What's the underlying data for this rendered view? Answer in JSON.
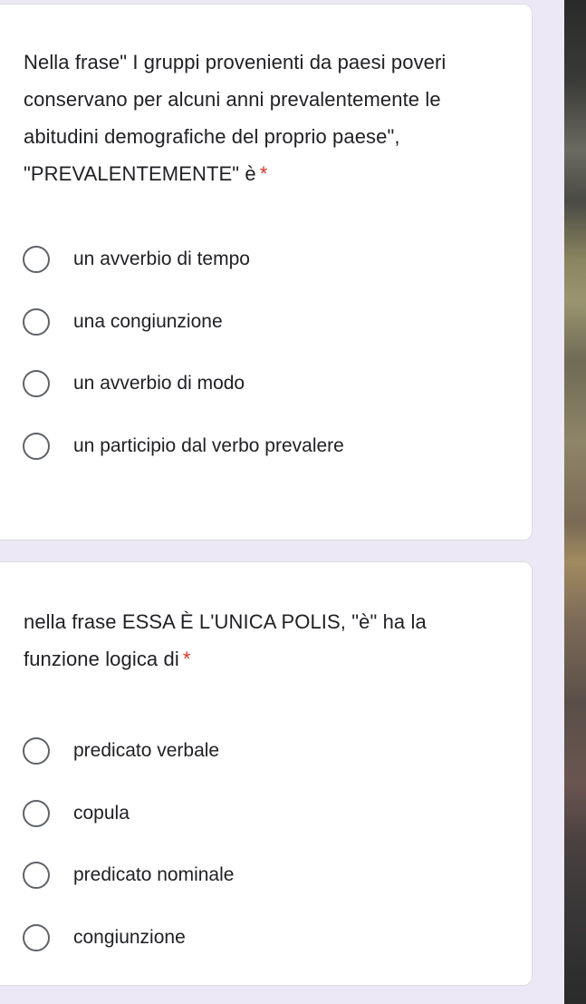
{
  "questions": [
    {
      "text": "Nella frase\" I gruppi provenienti da paesi poveri conservano per alcuni anni prevalentemente  le abitudini demografiche del proprio paese\", \"PREVALENTEMENTE\" è",
      "required_marker": "*",
      "options": [
        {
          "label": "un avverbio di tempo",
          "selected": false
        },
        {
          "label": "una congiunzione",
          "selected": false
        },
        {
          "label": "un avverbio di modo",
          "selected": false
        },
        {
          "label": "un participio dal verbo prevalere",
          "selected": false
        }
      ]
    },
    {
      "text": "nella frase ESSA  È L'UNICA POLIS, \"è\" ha la funzione logica di",
      "required_marker": "*",
      "options": [
        {
          "label": "predicato verbale",
          "selected": false
        },
        {
          "label": "copula",
          "selected": false
        },
        {
          "label": "predicato nominale",
          "selected": false
        },
        {
          "label": "congiunzione",
          "selected": false
        }
      ]
    }
  ],
  "colors": {
    "background": "#ede8f5",
    "card": "#ffffff",
    "required": "#d93025",
    "radio_border": "#5f6368",
    "text": "#202124"
  }
}
